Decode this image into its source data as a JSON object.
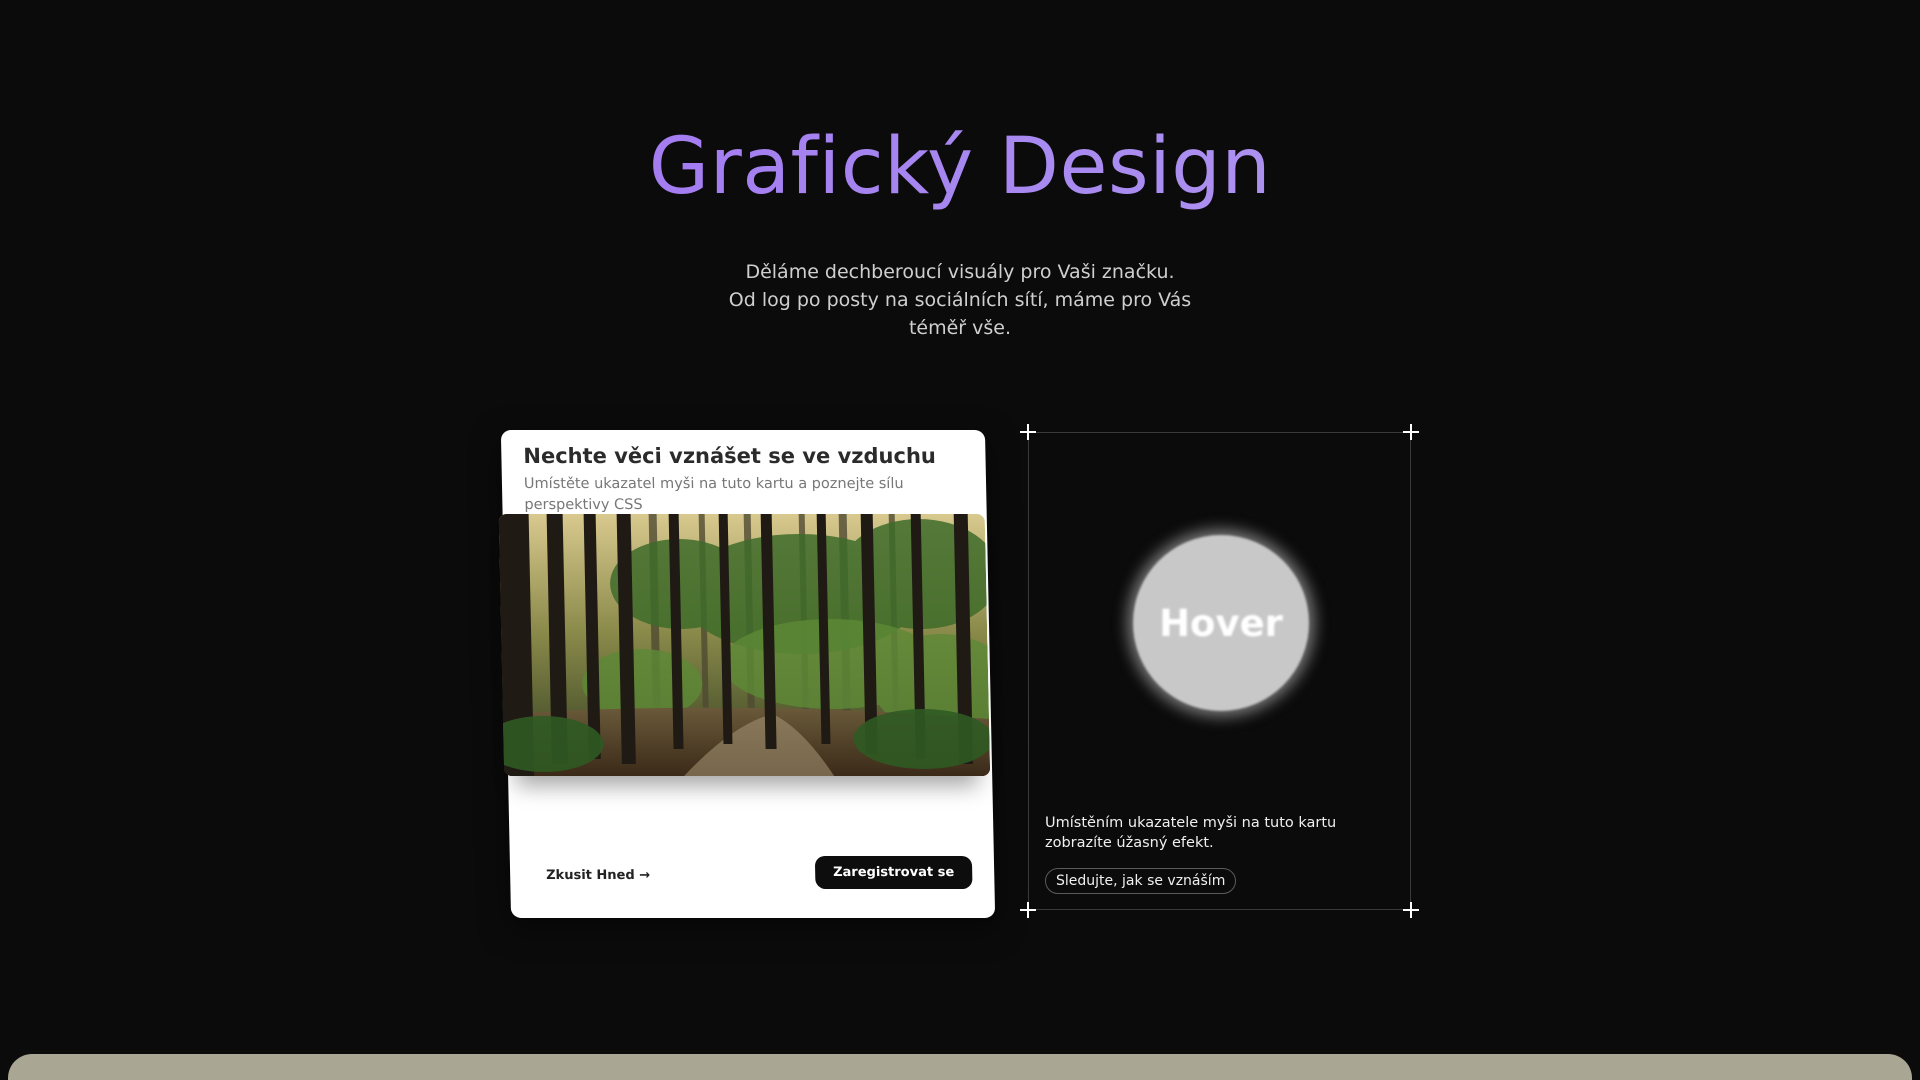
{
  "hero": {
    "title": "Grafický Design",
    "subtitle_line1": "Děláme dechberoucí visuály pro Vaši značku.",
    "subtitle_line2": "Od log po posty na sociálních sítí, máme pro Vás téměř vše."
  },
  "tilt_card": {
    "title": "Nechte věci vznášet se ve vzduchu",
    "description": "Umístěte ukazatel myši na tuto kartu a poznejte sílu perspektivy CSS",
    "link_label": "Zkusit Hned →",
    "button_label": "Zaregistrovat se",
    "image_icon": "forest-image"
  },
  "hover_card": {
    "orb_label": "Hover",
    "description": "Umístěním ukazatele myši na tuto kartu zobrazíte úžasný efekt.",
    "pill_label": "Sledujte, jak se vznáším"
  },
  "colors": {
    "background": "#0b0b0c",
    "title_gradient_start": "#9d68f2",
    "title_gradient_end": "#b9a3ef",
    "bottom_panel": "#aaa694"
  }
}
